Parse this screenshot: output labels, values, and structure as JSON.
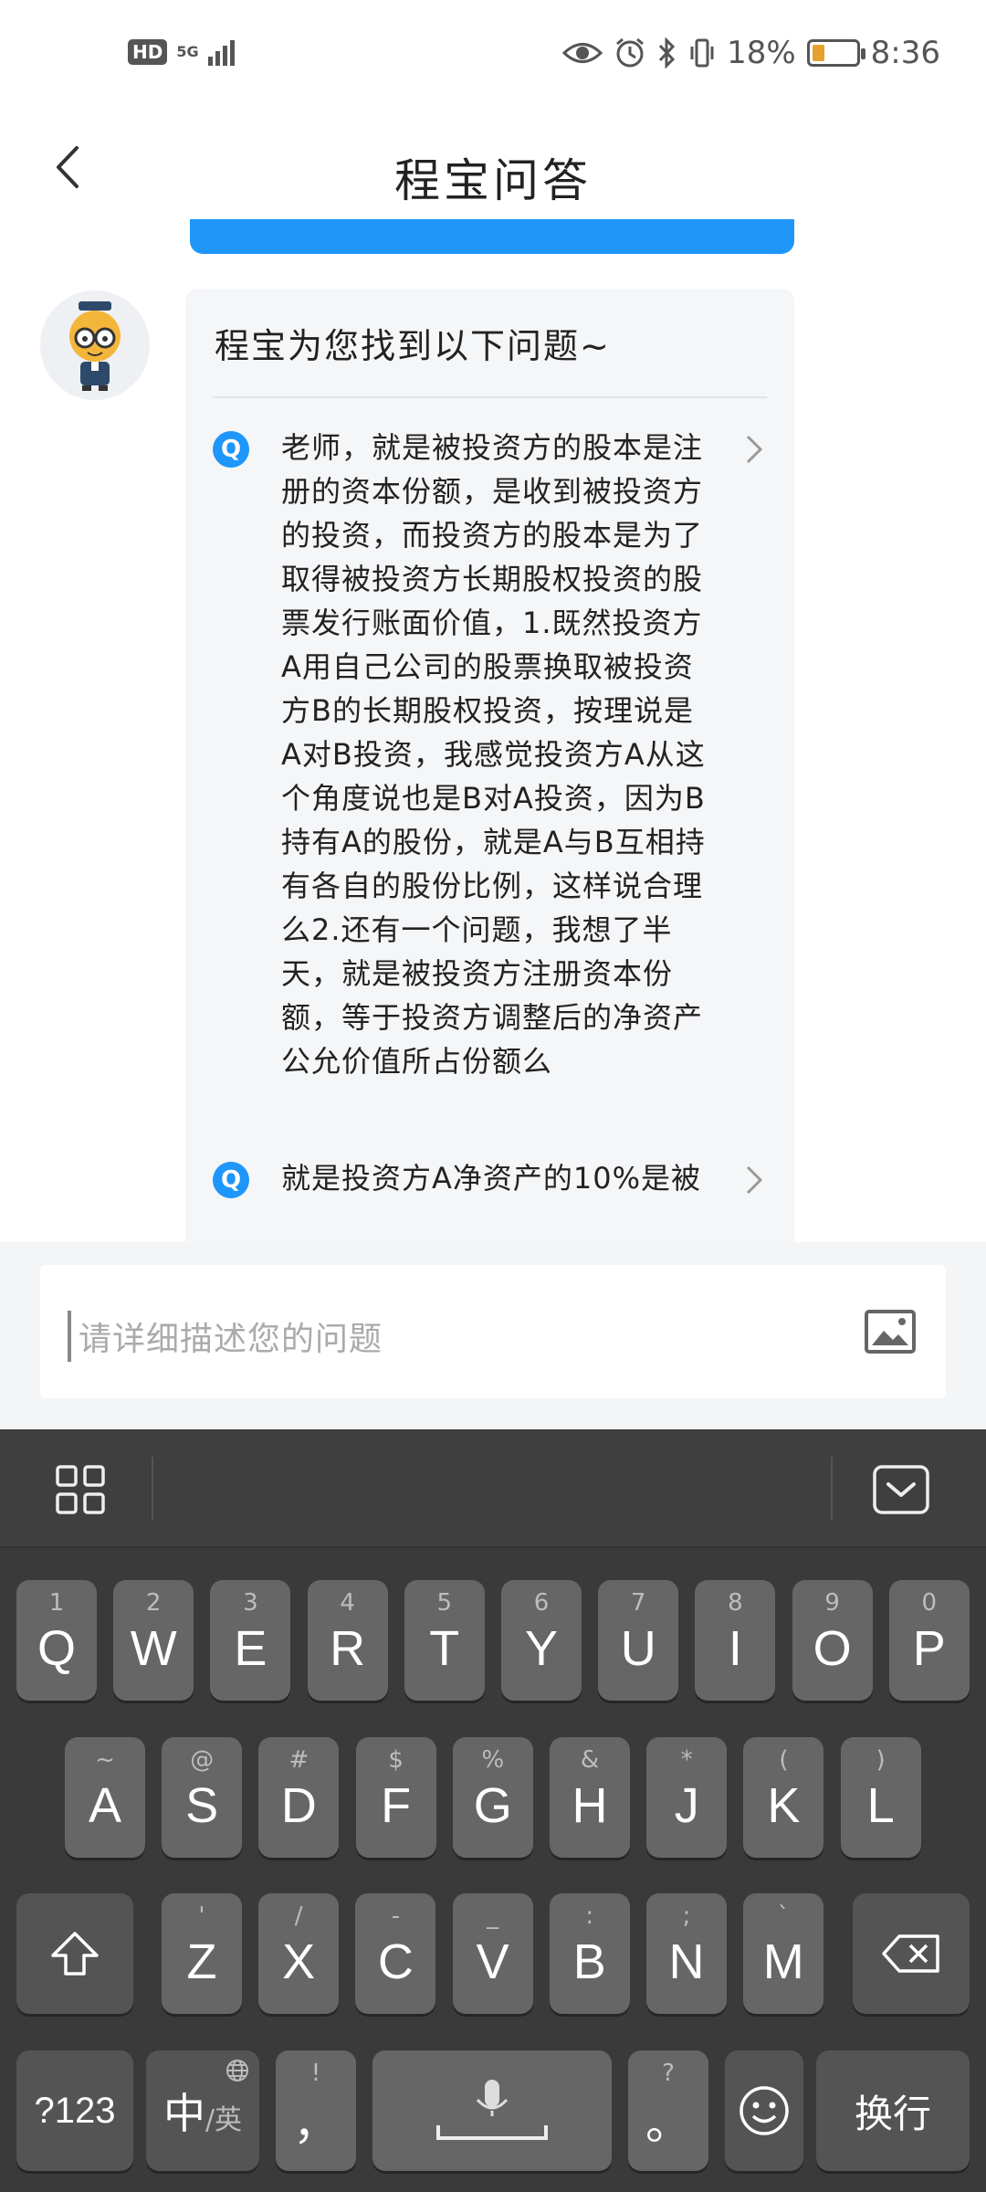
{
  "status_bar": {
    "hd_badge": "HD",
    "network": "5G",
    "battery_text": "18%",
    "time": "8:36"
  },
  "header": {
    "title": "程宝问答"
  },
  "chat": {
    "bubble_title": "程宝为您找到以下问题~",
    "q_badge": "Q",
    "questions": [
      "老师，就是被投资方的股本是注册的资本份额，是收到被投资方的投资，而投资方的股本是为了取得被投资方长期股权投资的股票发行账面价值，1.既然投资方A用自己公司的股票换取被投资方B的长期股权投资，按理说是A对B投资，我感觉投资方A从这个角度说也是B对A投资，因为B持有A的股份，就是A与B互相持有各自的股份比例，这样说合理么2.还有一个问题，我想了半天，就是被投资方注册资本份额，等于投资方调整后的净资产公允价值所占份额么",
      "就是投资方A净资产的10%是被"
    ]
  },
  "input": {
    "placeholder": "请详细描述您的问题"
  },
  "keyboard": {
    "row1": [
      {
        "main": "Q",
        "sub": "1"
      },
      {
        "main": "W",
        "sub": "2"
      },
      {
        "main": "E",
        "sub": "3"
      },
      {
        "main": "R",
        "sub": "4"
      },
      {
        "main": "T",
        "sub": "5"
      },
      {
        "main": "Y",
        "sub": "6"
      },
      {
        "main": "U",
        "sub": "7"
      },
      {
        "main": "I",
        "sub": "8"
      },
      {
        "main": "O",
        "sub": "9"
      },
      {
        "main": "P",
        "sub": "0"
      }
    ],
    "row2": [
      {
        "main": "A",
        "sub": "~"
      },
      {
        "main": "S",
        "sub": "@"
      },
      {
        "main": "D",
        "sub": "#"
      },
      {
        "main": "F",
        "sub": "$"
      },
      {
        "main": "G",
        "sub": "%"
      },
      {
        "main": "H",
        "sub": "&"
      },
      {
        "main": "J",
        "sub": "*"
      },
      {
        "main": "K",
        "sub": "("
      },
      {
        "main": "L",
        "sub": ")"
      }
    ],
    "row3": [
      {
        "main": "Z",
        "sub": "'"
      },
      {
        "main": "X",
        "sub": "/"
      },
      {
        "main": "C",
        "sub": "-"
      },
      {
        "main": "V",
        "sub": "_"
      },
      {
        "main": "B",
        "sub": ":"
      },
      {
        "main": "N",
        "sub": ";"
      },
      {
        "main": "M",
        "sub": "`"
      }
    ],
    "num_key": "?123",
    "lang_key_main": "中",
    "lang_key_sub": "/英",
    "comma_key": "，",
    "comma_sub": "!",
    "period_key": "。",
    "period_sub": "?",
    "enter_key": "换行"
  },
  "colors": {
    "accent_blue": "#1e96fa",
    "keyboard_bg": "#3a3a3a",
    "key_bg": "#666666"
  }
}
